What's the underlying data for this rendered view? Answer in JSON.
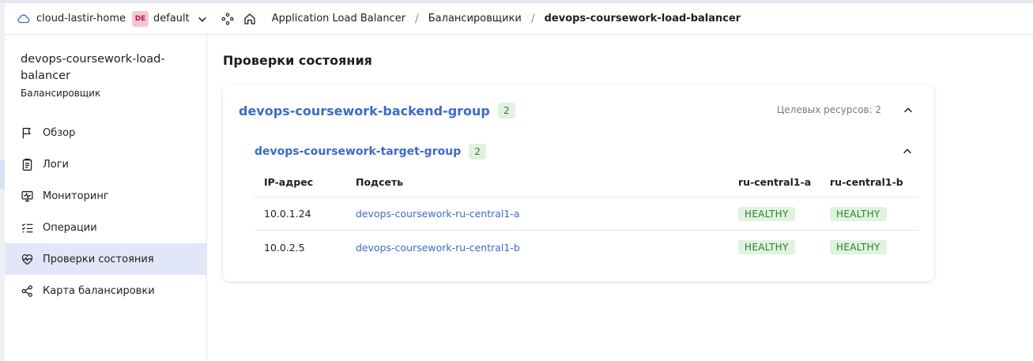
{
  "header": {
    "cloud_name": "cloud-lastir-home",
    "folder_badge": "DE",
    "folder_name": "default",
    "breadcrumbs": [
      "Application Load Balancer",
      "Балансировщики",
      "devops-coursework-load-balancer"
    ],
    "separator": "/"
  },
  "sidebar": {
    "title": "devops-coursework-load-balancer",
    "subtitle": "Балансировщик",
    "items": [
      {
        "label": "Обзор",
        "icon": "flag-icon",
        "active": false
      },
      {
        "label": "Логи",
        "icon": "logs-icon",
        "active": false
      },
      {
        "label": "Мониторинг",
        "icon": "monitoring-icon",
        "active": false
      },
      {
        "label": "Операции",
        "icon": "operations-icon",
        "active": false
      },
      {
        "label": "Проверки состояния",
        "icon": "heartbeat-icon",
        "active": true
      },
      {
        "label": "Карта балансировки",
        "icon": "map-icon",
        "active": false
      }
    ]
  },
  "main": {
    "title": "Проверки состояния",
    "backend_group": {
      "name": "devops-coursework-backend-group",
      "count": "2",
      "target_resources": "Целевых ресурсов: 2"
    },
    "target_group": {
      "name": "devops-coursework-target-group",
      "count": "2"
    },
    "table": {
      "columns": [
        "IP-адрес",
        "Подсеть",
        "ru-central1-a",
        "ru-central1-b"
      ],
      "rows": [
        {
          "ip": "10.0.1.24",
          "subnet": "devops-coursework-ru-central1-a",
          "a": "HEALTHY",
          "b": "HEALTHY"
        },
        {
          "ip": "10.0.2.5",
          "subnet": "devops-coursework-ru-central1-b",
          "a": "HEALTHY",
          "b": "HEALTHY"
        }
      ]
    }
  },
  "colors": {
    "accent": "#3c6ac8",
    "active_nav": "#e1e7f8",
    "healthy_bg": "#dff3df",
    "healthy_text": "#2e7d32",
    "folder_badge_bg": "#f7c6d4"
  }
}
